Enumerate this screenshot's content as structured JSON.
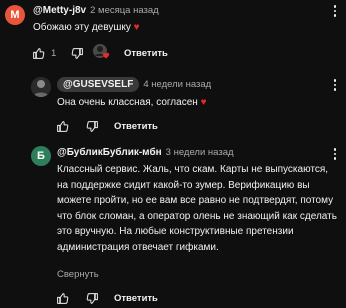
{
  "comments": [
    {
      "avatar_letter": "M",
      "avatar_color": "#e8553b",
      "author": "@Metty-j8v",
      "time": "2 месяца назад",
      "text": "Обожаю эту девушку",
      "text_emoji": "♥",
      "like_count": "1",
      "reply_label": "Ответить"
    },
    {
      "author": "@GUSEVSELF",
      "time": "4 недели назад",
      "text": "Она очень классная, согласен",
      "text_emoji": "♥",
      "reply_label": "Ответить"
    },
    {
      "avatar_letter": "Б",
      "avatar_color": "#2e7d5b",
      "author": "@БубликБублик-мбн",
      "time": "3 недели назад",
      "text": "Классный сервис. Жаль, что скам. Карты не выпускаются, на поддержке сидит какой-то зумер. Верификацию вы можете пройти, но ее вам все равно не подтвердят, потому что блок сломан, а оператор олень не знающий как сделать это вручную. На любые конструктивные претензии администрация отвечает гифками.",
      "collapse_label": "Свернуть",
      "reply_label": "Ответить"
    }
  ],
  "icons": {
    "like": "thumb-up-icon",
    "dislike": "thumb-down-icon",
    "more": "more-vert-icon",
    "creator_heart": "creator-heart-icon"
  },
  "colors": {
    "background": "#0f0f0f",
    "text": "#f1f1f1",
    "muted": "#aaaaaa",
    "heart": "#e52b2b"
  }
}
